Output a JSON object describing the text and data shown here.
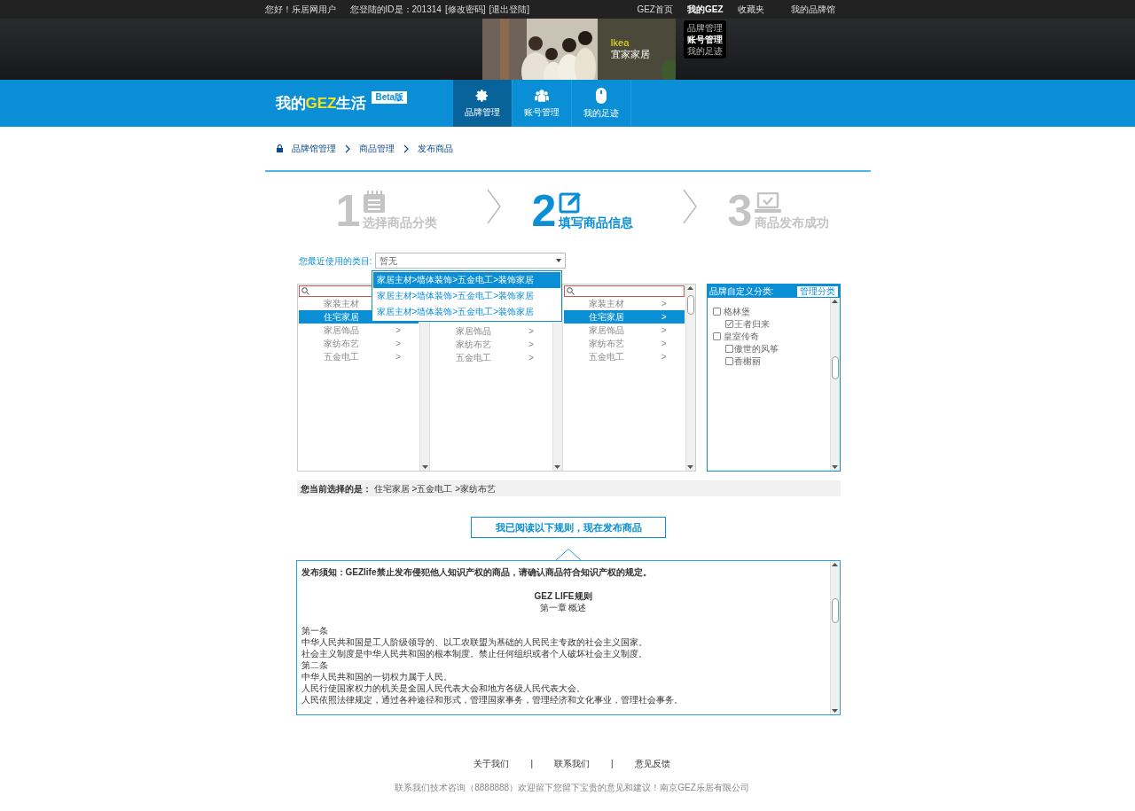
{
  "top_bar": {
    "greeting": "您好！乐居网用户",
    "user_id": "您登陆的ID是：201314",
    "links": [
      "[修改密码]",
      "[退出登陆]"
    ],
    "nav": [
      {
        "label": "GEZ首页",
        "selected": false
      },
      {
        "label": "我的GEZ",
        "selected": true
      },
      {
        "label": "收藏夹",
        "selected": false
      },
      {
        "label": "我的品牌馆",
        "selected": false
      }
    ],
    "menu": [
      {
        "label": "品牌管理",
        "selected": false
      },
      {
        "label": "账号管理",
        "selected": true
      },
      {
        "label": "我的足迹",
        "selected": false
      }
    ]
  },
  "banner": {
    "brand": "Ikea",
    "brand_cn": "宜家家居"
  },
  "header": {
    "logo": {
      "prefix": "我的",
      "highlight": "GEZ",
      "suffix": "生活"
    },
    "badge": "Beta版",
    "tabs": [
      {
        "label": "品牌管理",
        "selected": true
      },
      {
        "label": "账号管理",
        "selected": false
      },
      {
        "label": "我的足迹",
        "selected": false
      }
    ]
  },
  "breadcrumb": [
    "品牌馆管理",
    "商品管理",
    "发布商品"
  ],
  "steps": [
    {
      "number": "1",
      "label": "选择商品分类",
      "selected": false
    },
    {
      "number": "2",
      "label": "填写商品信息",
      "selected": true
    },
    {
      "number": "3",
      "label": "商品发布成功",
      "selected": false
    }
  ],
  "recent": {
    "label": "您最近使用的类目:",
    "value": "暂无",
    "options": [
      {
        "label": "家居主材>墙体装饰>五金电工>装饰家居",
        "selected": true
      },
      {
        "label": "家居主材>墙体装饰>五金电工>装饰家居",
        "selected": false
      },
      {
        "label": "家居主材>墙体装饰>五金电工>装饰家居",
        "selected": false
      }
    ]
  },
  "columns": [
    {
      "covered": false,
      "items": [
        {
          "label": "家装主材",
          "selected": false
        },
        {
          "label": "住宅家居",
          "selected": true
        },
        {
          "label": "家居饰品",
          "arrow": ">",
          "selected": false
        },
        {
          "label": "家纺布艺",
          "arrow": ">",
          "selected": false
        },
        {
          "label": "五金电工",
          "arrow": ">",
          "selected": false
        }
      ]
    },
    {
      "covered": true,
      "items": [
        {
          "label": "家居饰品",
          "arrow": ">",
          "selected": false
        },
        {
          "label": "家纺布艺",
          "arrow": ">",
          "selected": false
        },
        {
          "label": "五金电工",
          "arrow": ">",
          "selected": false
        }
      ]
    },
    {
      "covered": false,
      "items": [
        {
          "label": "家装主材",
          "arrow": ">",
          "selected": false
        },
        {
          "label": "住宅家居",
          "arrow": ">",
          "selected": true
        },
        {
          "label": "家居饰品",
          "arrow": ">",
          "selected": false
        },
        {
          "label": "家纺布艺",
          "arrow": ">",
          "selected": false
        },
        {
          "label": "五金电工",
          "arrow": ">",
          "selected": false
        }
      ]
    }
  ],
  "brand_categories": {
    "title": "品牌自定义分类:",
    "manage": "管理分类",
    "tree": [
      {
        "label": "格林堡",
        "checked": false,
        "children": [
          {
            "label": "王者归来",
            "checked": true
          }
        ]
      },
      {
        "label": "皇室传奇",
        "checked": false,
        "children": [
          {
            "label": "傲世的风筝",
            "checked": false
          },
          {
            "label": "香榭丽",
            "checked": false
          }
        ]
      }
    ]
  },
  "selection": {
    "label": "您当前选择的是：",
    "path": [
      "住宅家居",
      ">五金电工",
      ">家纺布艺"
    ]
  },
  "confirm_button": "我已阅读以下规则，现在发布商品",
  "rules": {
    "notice": "发布须知：GEZlife禁止发布侵犯他人知识产权的商品，请确认商品符合知识产权的规定。",
    "title": "GEZ LIFE规则",
    "chapter": "第一章 概述",
    "lines": [
      "第一条",
      "中华人民共和国是工人阶级领导的、以工农联盟为基础的人民民主专政的社会主义国家。",
      "社会主义制度是中华人民共和国的根本制度。禁止任何组织或者个人破坏社会主义制度。",
      "第二条",
      "中华人民共和国的一切权力属于人民。",
      "人民行使国家权力的机关是全国人民代表大会和地方各级人民代表大会。",
      "人民依照法律规定，通过各种途径和形式，管理国家事务，管理经济和文化事业，管理社会事务。"
    ]
  },
  "footer": {
    "links": [
      {
        "kind": "link",
        "label": "关于我们"
      },
      {
        "kind": "separator",
        "label": "|"
      },
      {
        "kind": "link",
        "label": "联系我们"
      },
      {
        "kind": "separator",
        "label": "|"
      },
      {
        "kind": "link",
        "label": "意见反馈"
      }
    ],
    "text": "联系我们技术咨询（8888888）欢迎留下您留下宝贵的意见和建议！南京GEZ乐居有限公司"
  }
}
